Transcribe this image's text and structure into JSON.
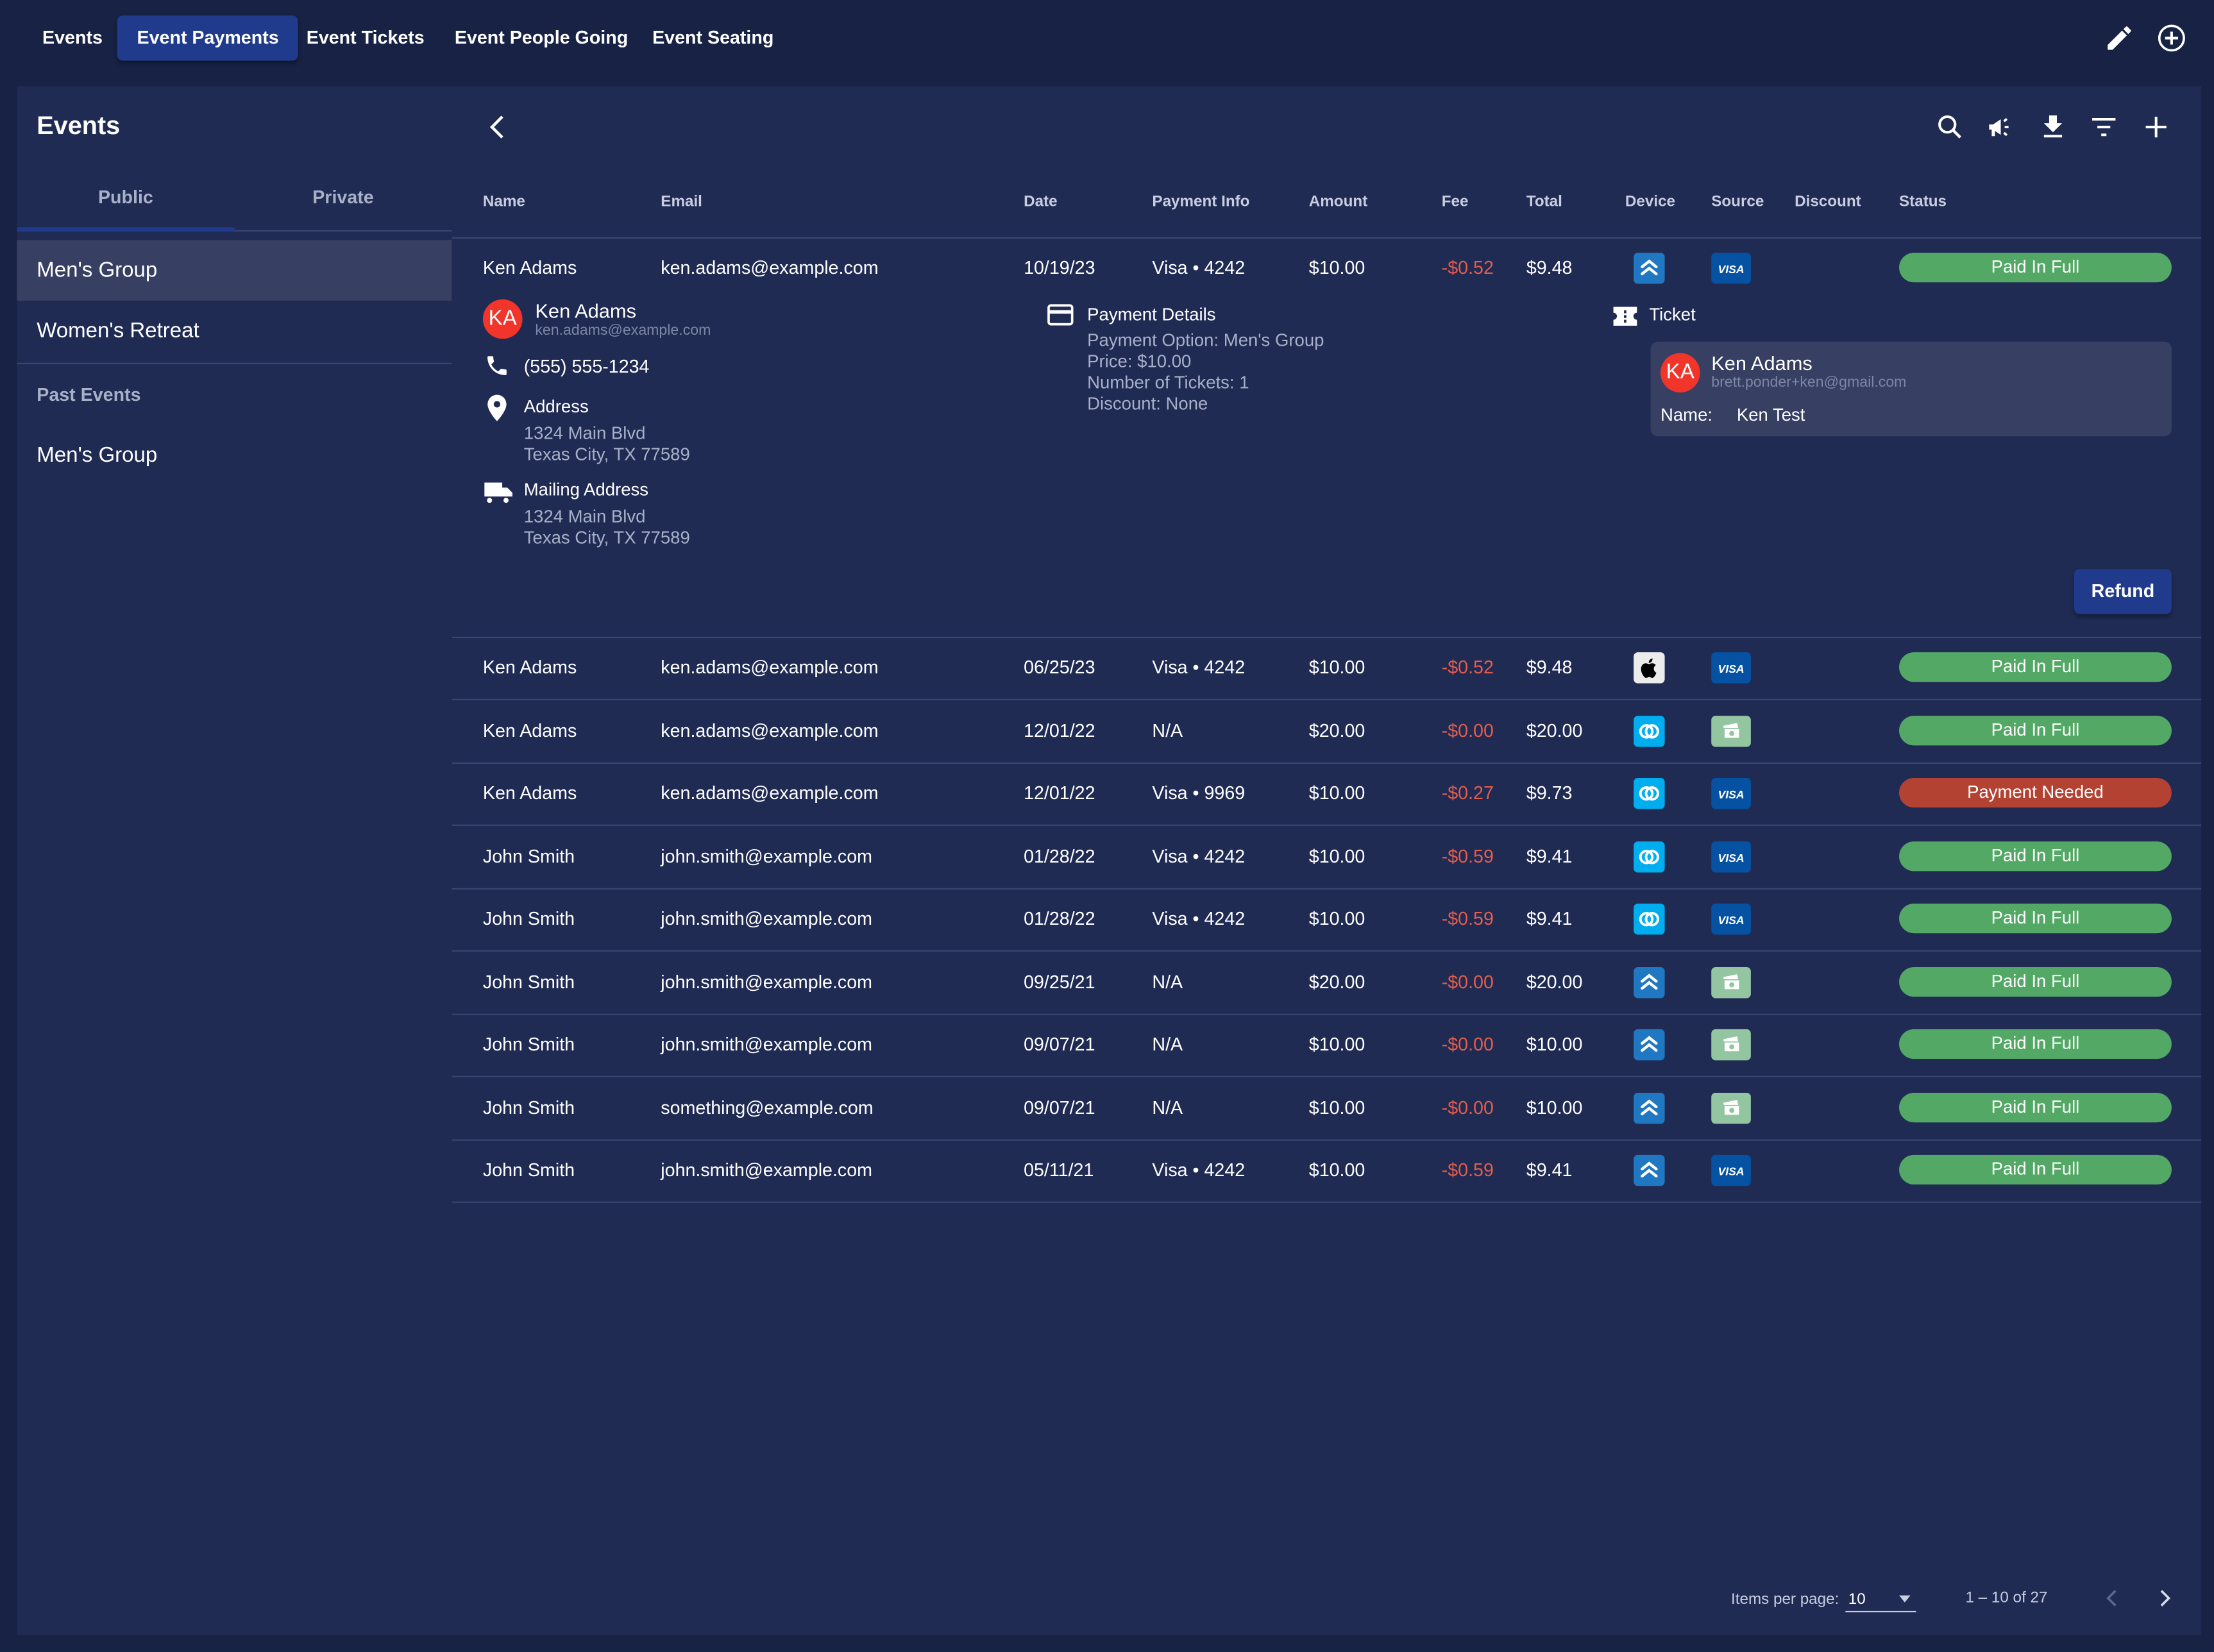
{
  "topnav": {
    "tabs": [
      {
        "label": "Events",
        "active": false
      },
      {
        "label": "Event Payments",
        "active": true
      },
      {
        "label": "Event Tickets",
        "active": false
      },
      {
        "label": "Event People Going",
        "active": false
      },
      {
        "label": "Event Seating",
        "active": false
      }
    ],
    "icons": [
      "pencil-icon",
      "add-circle-icon"
    ]
  },
  "sidebar": {
    "title": "Events",
    "subtabs": [
      {
        "label": "Public",
        "active": true
      },
      {
        "label": "Private",
        "active": false
      }
    ],
    "items": [
      {
        "label": "Men's Group",
        "active": true
      },
      {
        "label": "Women's Retreat",
        "active": false
      }
    ],
    "past_header": "Past Events",
    "past_items": [
      {
        "label": "Men's Group"
      }
    ]
  },
  "toolbar": {
    "icons": [
      "search-icon",
      "campaign-icon",
      "download-icon",
      "filter-icon",
      "add-icon"
    ]
  },
  "table": {
    "columns": [
      "Name",
      "Email",
      "Date",
      "Payment Info",
      "Amount",
      "Fee",
      "Total",
      "Device",
      "Source",
      "Discount",
      "Status"
    ],
    "rows": [
      {
        "name": "Ken Adams",
        "email": "ken.adams@example.com",
        "date": "10/19/23",
        "payment": "Visa • 4242",
        "amount": "$10.00",
        "fee": "-$0.52",
        "total": "$9.48",
        "device": "web",
        "source": "visa",
        "discount": "",
        "status": "Paid In Full"
      },
      {
        "name": "Ken Adams",
        "email": "ken.adams@example.com",
        "date": "06/25/23",
        "payment": "Visa • 4242",
        "amount": "$10.00",
        "fee": "-$0.52",
        "total": "$9.48",
        "device": "apple",
        "source": "visa",
        "discount": "",
        "status": "Paid In Full"
      },
      {
        "name": "Ken Adams",
        "email": "ken.adams@example.com",
        "date": "12/01/22",
        "payment": "N/A",
        "amount": "$20.00",
        "fee": "-$0.00",
        "total": "$20.00",
        "device": "rings",
        "source": "cash",
        "discount": "",
        "status": "Paid In Full"
      },
      {
        "name": "Ken Adams",
        "email": "ken.adams@example.com",
        "date": "12/01/22",
        "payment": "Visa • 9969",
        "amount": "$10.00",
        "fee": "-$0.27",
        "total": "$9.73",
        "device": "rings",
        "source": "visa",
        "discount": "",
        "status": "Payment Needed"
      },
      {
        "name": "John Smith",
        "email": "john.smith@example.com",
        "date": "01/28/22",
        "payment": "Visa • 4242",
        "amount": "$10.00",
        "fee": "-$0.59",
        "total": "$9.41",
        "device": "rings",
        "source": "visa",
        "discount": "",
        "status": "Paid In Full"
      },
      {
        "name": "John Smith",
        "email": "john.smith@example.com",
        "date": "01/28/22",
        "payment": "Visa • 4242",
        "amount": "$10.00",
        "fee": "-$0.59",
        "total": "$9.41",
        "device": "rings",
        "source": "visa",
        "discount": "",
        "status": "Paid In Full"
      },
      {
        "name": "John Smith",
        "email": "john.smith@example.com",
        "date": "09/25/21",
        "payment": "N/A",
        "amount": "$20.00",
        "fee": "-$0.00",
        "total": "$20.00",
        "device": "web",
        "source": "cash",
        "discount": "",
        "status": "Paid In Full"
      },
      {
        "name": "John Smith",
        "email": "john.smith@example.com",
        "date": "09/07/21",
        "payment": "N/A",
        "amount": "$10.00",
        "fee": "-$0.00",
        "total": "$10.00",
        "device": "web",
        "source": "cash",
        "discount": "",
        "status": "Paid In Full"
      },
      {
        "name": "John Smith",
        "email": "something@example.com",
        "date": "09/07/21",
        "payment": "N/A",
        "amount": "$10.00",
        "fee": "-$0.00",
        "total": "$10.00",
        "device": "web",
        "source": "cash",
        "discount": "",
        "status": "Paid In Full"
      },
      {
        "name": "John Smith",
        "email": "john.smith@example.com",
        "date": "05/11/21",
        "payment": "Visa • 4242",
        "amount": "$10.00",
        "fee": "-$0.59",
        "total": "$9.41",
        "device": "web",
        "source": "visa",
        "discount": "",
        "status": "Paid In Full"
      }
    ]
  },
  "expanded": {
    "person": {
      "initials": "KA",
      "name": "Ken Adams",
      "email": "ken.adams@example.com",
      "phone": "(555) 555-1234",
      "address_label": "Address",
      "address_line1": "1324 Main Blvd",
      "address_line2": "Texas City, TX 77589",
      "mailing_label": "Mailing Address",
      "mailing_line1": "1324 Main Blvd",
      "mailing_line2": "Texas City, TX 77589"
    },
    "payment_details": {
      "title": "Payment Details",
      "lines": [
        "Payment Option: Men's Group",
        "Price: $10.00",
        "Number of Tickets: 1",
        "Discount: None"
      ]
    },
    "ticket": {
      "title": "Ticket",
      "initials": "KA",
      "name": "Ken Adams",
      "email": "brett.ponder+ken@gmail.com",
      "name_label": "Name:",
      "name_value": "Ken Test"
    },
    "refund_label": "Refund"
  },
  "paginator": {
    "items_per_page_label": "Items per page:",
    "items_per_page": "10",
    "range": "1 – 10 of 27"
  },
  "colors": {
    "background": "#172245",
    "panel": "#202b54",
    "accent": "#213b8c",
    "paid": "#53a865",
    "needed": "#b34233",
    "fee": "#e35c4c",
    "avatar": "#f2352b",
    "visa": "#0552a3",
    "cash": "#93c6a0",
    "device_web": "#1f78c1",
    "device_rings": "#00aeef",
    "device_apple": "#ececec"
  }
}
